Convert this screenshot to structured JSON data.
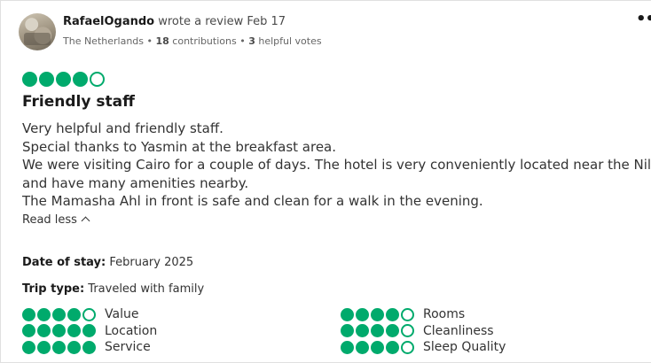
{
  "reviewer": {
    "name": "RafaelOgando",
    "action": " wrote a review Feb 17",
    "location": "The Netherlands",
    "separator": " • ",
    "contributions_count": "18",
    "contributions_label": " contributions",
    "helpful_count": "3",
    "helpful_label": " helpful votes"
  },
  "more_icon": "more-horizontal-icon",
  "review": {
    "rating": 4,
    "rating_max": 5,
    "title": "Friendly staff",
    "body_lines": [
      "Very helpful and friendly staff.",
      "Special thanks to Yasmin at the breakfast area.",
      "We were visiting Cairo for a couple of days. The hotel is very conveniently located near the Nile",
      "and have many amenities nearby.",
      "The Mamasha Ahl in front is safe and clean for a walk in the evening."
    ],
    "read_less": "Read less"
  },
  "details": {
    "date_label": "Date of stay:",
    "date_value": " February 2025",
    "trip_label": "Trip type:",
    "trip_value": " Traveled with family"
  },
  "sub_ratings": [
    {
      "label": "Value",
      "rating": 4
    },
    {
      "label": "Location",
      "rating": 5
    },
    {
      "label": "Service",
      "rating": 5
    },
    {
      "label": "Rooms",
      "rating": 4
    },
    {
      "label": "Cleanliness",
      "rating": 4
    },
    {
      "label": "Sleep Quality",
      "rating": 4
    }
  ],
  "colors": {
    "bubble": "#00aa6c",
    "text": "#1a1a1a"
  }
}
